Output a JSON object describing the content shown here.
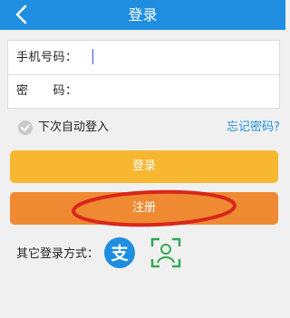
{
  "header": {
    "title": "登录"
  },
  "form": {
    "phone_label": "手机号码：",
    "password_label": "密　　码："
  },
  "options": {
    "remember_label": "下次自动登入",
    "forgot_label": "忘记密码?"
  },
  "buttons": {
    "login_label": "登录",
    "register_label": "注册"
  },
  "alternative": {
    "label": "其它登录方式：",
    "icons": [
      "alipay-icon",
      "face-scan-icon"
    ]
  },
  "colors": {
    "header": "#1f8ee0",
    "login": "#f7b731",
    "register": "#f08a32",
    "annotation": "#d9261c",
    "alipay": "#1f8ee0",
    "face": "#32a852"
  }
}
